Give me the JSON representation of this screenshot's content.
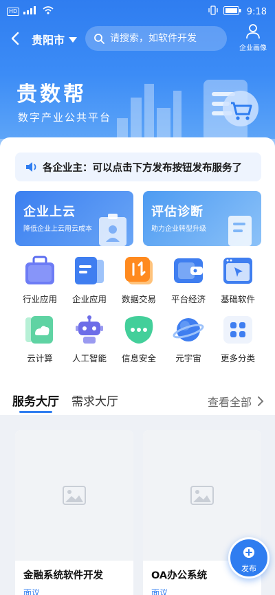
{
  "status_bar": {
    "network": "HD",
    "time": "9:18"
  },
  "nav": {
    "city": "贵阳市",
    "search_placeholder": "请搜索，如软件开发",
    "profile_label": "企业画像"
  },
  "brand": {
    "title": "贵数帮",
    "subtitle": "数字产业公共平台"
  },
  "notice": {
    "text": "各企业主：可以点击下方发布按钮发布服务了"
  },
  "promos": [
    {
      "title": "企业上云",
      "subtitle": "降低企业上云用云成本"
    },
    {
      "title": "评估诊断",
      "subtitle": "助力企业转型升级"
    }
  ],
  "categories": [
    {
      "label": "行业应用",
      "icon": "briefcase-icon"
    },
    {
      "label": "企业应用",
      "icon": "folder-icon"
    },
    {
      "label": "数据交易",
      "icon": "data-exchange-icon"
    },
    {
      "label": "平台经济",
      "icon": "wallet-icon"
    },
    {
      "label": "基础软件",
      "icon": "window-cursor-icon"
    },
    {
      "label": "云计算",
      "icon": "cloud-icon"
    },
    {
      "label": "人工智能",
      "icon": "robot-icon"
    },
    {
      "label": "信息安全",
      "icon": "shield-chat-icon"
    },
    {
      "label": "元宇宙",
      "icon": "planet-icon"
    },
    {
      "label": "更多分类",
      "icon": "grid-dots-icon"
    }
  ],
  "tabs": {
    "active": "服务大厅",
    "inactive": "需求大厅",
    "see_all": "查看全部"
  },
  "services": [
    {
      "title": "金融系统软件开发",
      "tag": "面议"
    },
    {
      "title": "OA办公系统",
      "tag": "面议"
    }
  ],
  "fab": {
    "label": "发布"
  },
  "colors": {
    "primary": "#2f7df0",
    "notice_bg": "#eef4fe",
    "page_bg": "#eef1f6"
  }
}
